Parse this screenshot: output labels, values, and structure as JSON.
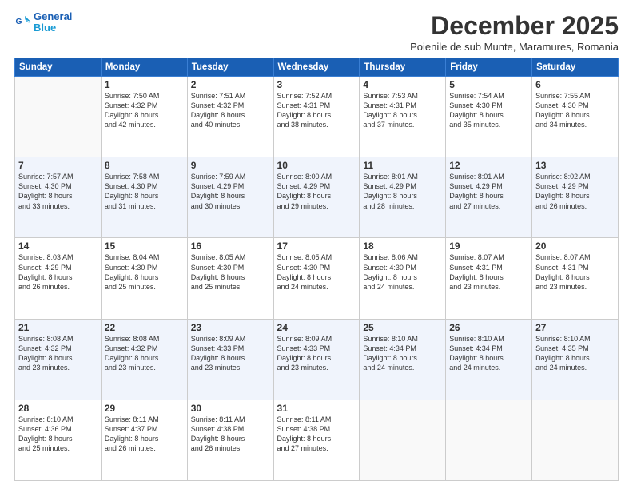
{
  "header": {
    "logo_line1": "General",
    "logo_line2": "Blue",
    "month": "December 2025",
    "location": "Poienile de sub Munte, Maramures, Romania"
  },
  "weekdays": [
    "Sunday",
    "Monday",
    "Tuesday",
    "Wednesday",
    "Thursday",
    "Friday",
    "Saturday"
  ],
  "weeks": [
    [
      {
        "day": "",
        "info": ""
      },
      {
        "day": "1",
        "info": "Sunrise: 7:50 AM\nSunset: 4:32 PM\nDaylight: 8 hours\nand 42 minutes."
      },
      {
        "day": "2",
        "info": "Sunrise: 7:51 AM\nSunset: 4:32 PM\nDaylight: 8 hours\nand 40 minutes."
      },
      {
        "day": "3",
        "info": "Sunrise: 7:52 AM\nSunset: 4:31 PM\nDaylight: 8 hours\nand 38 minutes."
      },
      {
        "day": "4",
        "info": "Sunrise: 7:53 AM\nSunset: 4:31 PM\nDaylight: 8 hours\nand 37 minutes."
      },
      {
        "day": "5",
        "info": "Sunrise: 7:54 AM\nSunset: 4:30 PM\nDaylight: 8 hours\nand 35 minutes."
      },
      {
        "day": "6",
        "info": "Sunrise: 7:55 AM\nSunset: 4:30 PM\nDaylight: 8 hours\nand 34 minutes."
      }
    ],
    [
      {
        "day": "7",
        "info": "Sunrise: 7:57 AM\nSunset: 4:30 PM\nDaylight: 8 hours\nand 33 minutes."
      },
      {
        "day": "8",
        "info": "Sunrise: 7:58 AM\nSunset: 4:30 PM\nDaylight: 8 hours\nand 31 minutes."
      },
      {
        "day": "9",
        "info": "Sunrise: 7:59 AM\nSunset: 4:29 PM\nDaylight: 8 hours\nand 30 minutes."
      },
      {
        "day": "10",
        "info": "Sunrise: 8:00 AM\nSunset: 4:29 PM\nDaylight: 8 hours\nand 29 minutes."
      },
      {
        "day": "11",
        "info": "Sunrise: 8:01 AM\nSunset: 4:29 PM\nDaylight: 8 hours\nand 28 minutes."
      },
      {
        "day": "12",
        "info": "Sunrise: 8:01 AM\nSunset: 4:29 PM\nDaylight: 8 hours\nand 27 minutes."
      },
      {
        "day": "13",
        "info": "Sunrise: 8:02 AM\nSunset: 4:29 PM\nDaylight: 8 hours\nand 26 minutes."
      }
    ],
    [
      {
        "day": "14",
        "info": "Sunrise: 8:03 AM\nSunset: 4:29 PM\nDaylight: 8 hours\nand 26 minutes."
      },
      {
        "day": "15",
        "info": "Sunrise: 8:04 AM\nSunset: 4:30 PM\nDaylight: 8 hours\nand 25 minutes."
      },
      {
        "day": "16",
        "info": "Sunrise: 8:05 AM\nSunset: 4:30 PM\nDaylight: 8 hours\nand 25 minutes."
      },
      {
        "day": "17",
        "info": "Sunrise: 8:05 AM\nSunset: 4:30 PM\nDaylight: 8 hours\nand 24 minutes."
      },
      {
        "day": "18",
        "info": "Sunrise: 8:06 AM\nSunset: 4:30 PM\nDaylight: 8 hours\nand 24 minutes."
      },
      {
        "day": "19",
        "info": "Sunrise: 8:07 AM\nSunset: 4:31 PM\nDaylight: 8 hours\nand 23 minutes."
      },
      {
        "day": "20",
        "info": "Sunrise: 8:07 AM\nSunset: 4:31 PM\nDaylight: 8 hours\nand 23 minutes."
      }
    ],
    [
      {
        "day": "21",
        "info": "Sunrise: 8:08 AM\nSunset: 4:32 PM\nDaylight: 8 hours\nand 23 minutes."
      },
      {
        "day": "22",
        "info": "Sunrise: 8:08 AM\nSunset: 4:32 PM\nDaylight: 8 hours\nand 23 minutes."
      },
      {
        "day": "23",
        "info": "Sunrise: 8:09 AM\nSunset: 4:33 PM\nDaylight: 8 hours\nand 23 minutes."
      },
      {
        "day": "24",
        "info": "Sunrise: 8:09 AM\nSunset: 4:33 PM\nDaylight: 8 hours\nand 23 minutes."
      },
      {
        "day": "25",
        "info": "Sunrise: 8:10 AM\nSunset: 4:34 PM\nDaylight: 8 hours\nand 24 minutes."
      },
      {
        "day": "26",
        "info": "Sunrise: 8:10 AM\nSunset: 4:34 PM\nDaylight: 8 hours\nand 24 minutes."
      },
      {
        "day": "27",
        "info": "Sunrise: 8:10 AM\nSunset: 4:35 PM\nDaylight: 8 hours\nand 24 minutes."
      }
    ],
    [
      {
        "day": "28",
        "info": "Sunrise: 8:10 AM\nSunset: 4:36 PM\nDaylight: 8 hours\nand 25 minutes."
      },
      {
        "day": "29",
        "info": "Sunrise: 8:11 AM\nSunset: 4:37 PM\nDaylight: 8 hours\nand 26 minutes."
      },
      {
        "day": "30",
        "info": "Sunrise: 8:11 AM\nSunset: 4:38 PM\nDaylight: 8 hours\nand 26 minutes."
      },
      {
        "day": "31",
        "info": "Sunrise: 8:11 AM\nSunset: 4:38 PM\nDaylight: 8 hours\nand 27 minutes."
      },
      {
        "day": "",
        "info": ""
      },
      {
        "day": "",
        "info": ""
      },
      {
        "day": "",
        "info": ""
      }
    ]
  ]
}
